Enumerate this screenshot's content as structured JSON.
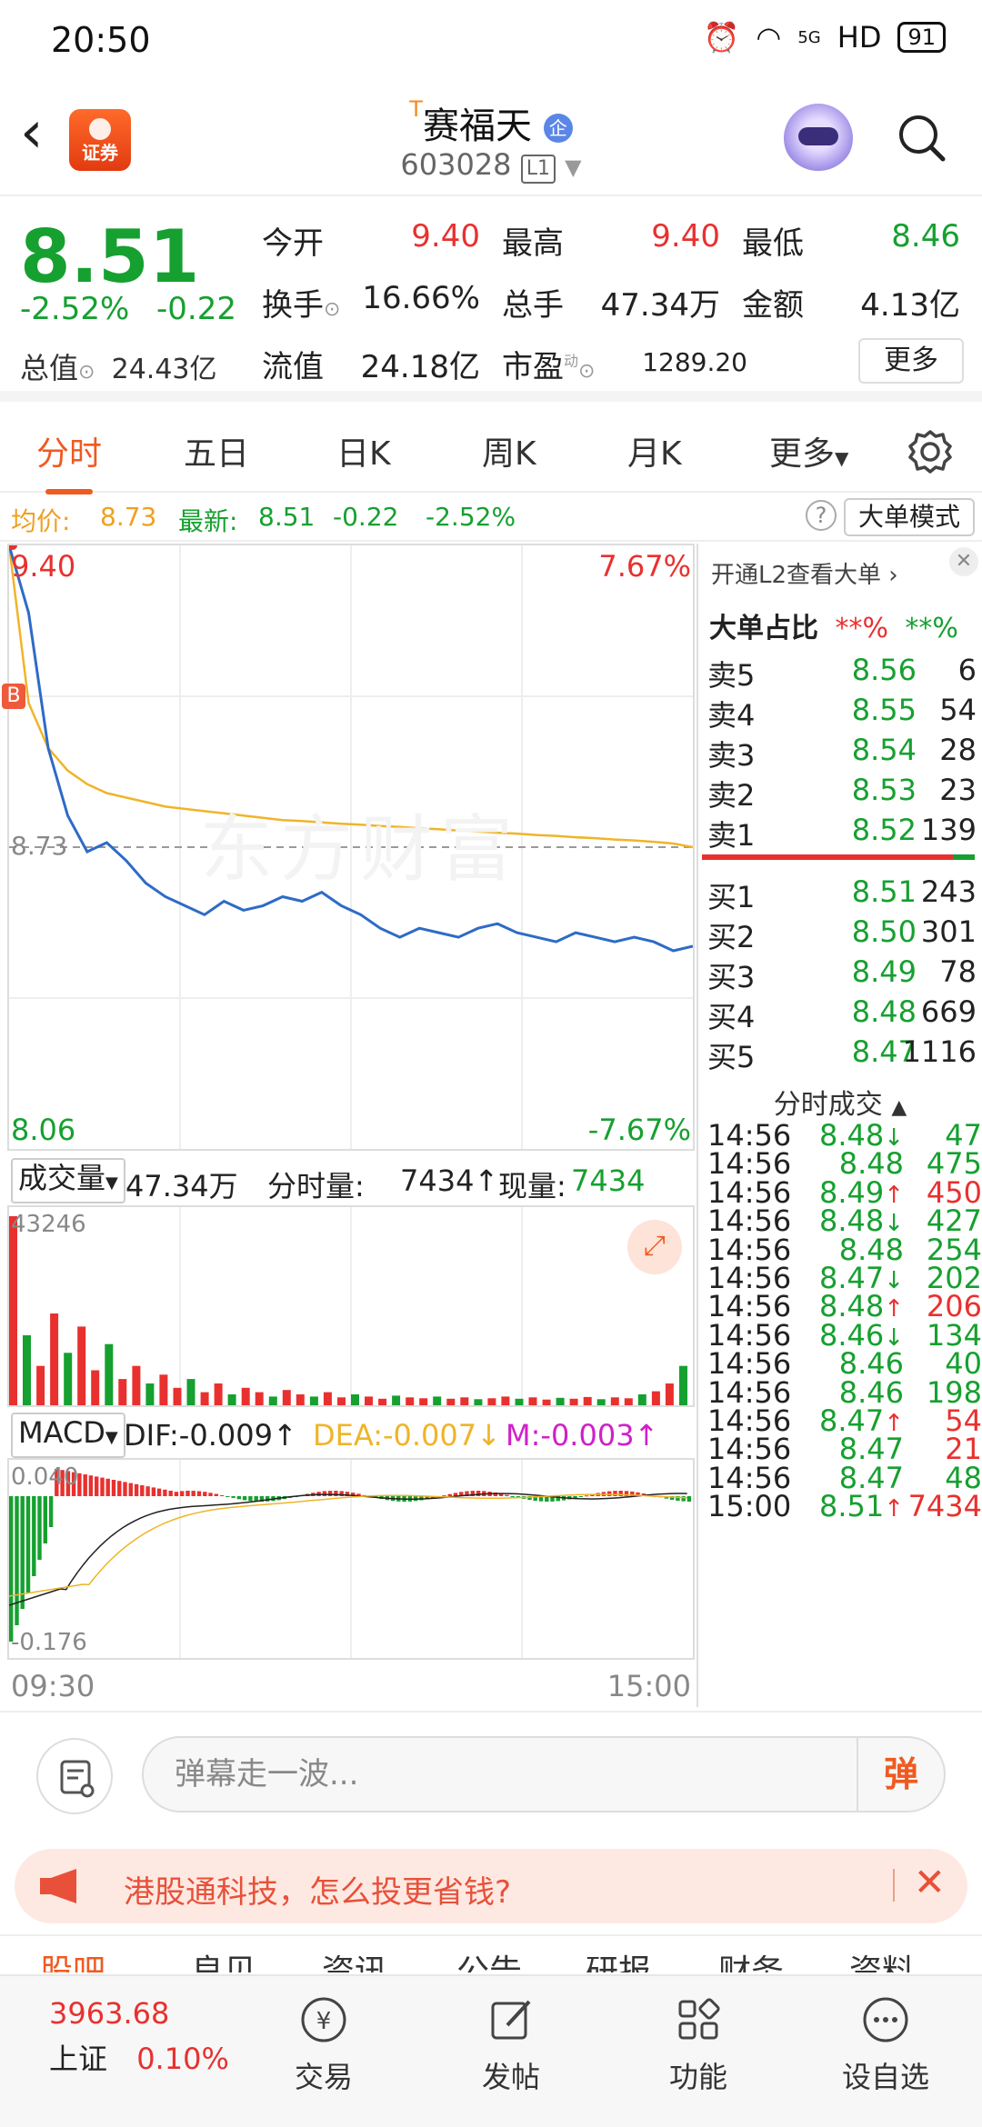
{
  "status_bar": {
    "time": "20:50",
    "network": "5G",
    "hd": "HD",
    "battery": "91"
  },
  "header": {
    "logo_label": "证券",
    "stock_name": "赛福天",
    "name_prefix": "T",
    "tag": "企",
    "stock_code": "603028",
    "level_badge": "L1"
  },
  "quote": {
    "price": "8.51",
    "change_pct": "-2.52%",
    "change": "-0.22",
    "open_label": "今开",
    "open": "9.40",
    "high_label": "最高",
    "high": "9.40",
    "low_label": "最低",
    "low": "8.46",
    "turnover_label": "换手",
    "turnover": "16.66%",
    "volume_label": "总手",
    "volume": "47.34万",
    "amount_label": "金额",
    "amount": "4.13亿",
    "mktcap_label": "总值",
    "mktcap": "24.43亿",
    "float_label": "流值",
    "float": "24.18亿",
    "pe_label": "市盈",
    "pe_sup": "动",
    "pe": "1289.20",
    "more_label": "更多"
  },
  "tabs": [
    "分时",
    "五日",
    "日K",
    "周K",
    "月K",
    "更多"
  ],
  "avg_row": {
    "avg_label": "均价:",
    "avg": "8.73",
    "latest_label": "最新:",
    "latest": "8.51",
    "chg": "-0.22",
    "chg_pct": "-2.52%",
    "help": "?",
    "mode_button": "大单模式"
  },
  "chart_labels": {
    "top_price": "9.40",
    "top_pct": "7.67%",
    "bottom_price": "8.06",
    "bottom_pct": "-7.67%",
    "mid_price": "8.73",
    "watermark": "东方财富",
    "b_marker": "B"
  },
  "chart_data": {
    "type": "line",
    "x_range": [
      "09:30",
      "15:00"
    ],
    "ylim": [
      8.06,
      9.4
    ],
    "prev_close": 8.73,
    "series": [
      {
        "name": "最新",
        "color": "#2e6bc6",
        "values": [
          9.4,
          9.25,
          8.95,
          8.8,
          8.72,
          8.74,
          8.7,
          8.65,
          8.62,
          8.6,
          8.58,
          8.61,
          8.59,
          8.6,
          8.62,
          8.61,
          8.63,
          8.6,
          8.58,
          8.55,
          8.53,
          8.55,
          8.54,
          8.53,
          8.55,
          8.56,
          8.54,
          8.53,
          8.52,
          8.54,
          8.53,
          8.52,
          8.53,
          8.52,
          8.5,
          8.51
        ]
      },
      {
        "name": "均价",
        "color": "#f0b429",
        "values": [
          9.4,
          9.05,
          8.95,
          8.9,
          8.87,
          8.85,
          8.84,
          8.83,
          8.82,
          8.815,
          8.81,
          8.805,
          8.8,
          8.795,
          8.79,
          8.788,
          8.785,
          8.782,
          8.78,
          8.777,
          8.775,
          8.772,
          8.77,
          8.767,
          8.765,
          8.762,
          8.76,
          8.757,
          8.755,
          8.752,
          8.75,
          8.747,
          8.745,
          8.742,
          8.738,
          8.73
        ]
      }
    ]
  },
  "volume": {
    "selector": "成交量",
    "total": "47.34万",
    "tick_label": "分时量:",
    "tick": "7434",
    "current_label": "现量:",
    "current": "7434",
    "max": "43246"
  },
  "volume_data": [
    43246,
    16000,
    9000,
    21000,
    12000,
    18000,
    8000,
    14000,
    6000,
    9000,
    5000,
    7000,
    4000,
    6000,
    3000,
    5000,
    2500,
    4000,
    3000,
    2000,
    3500,
    2500,
    2000,
    3000,
    1800,
    2500,
    2000,
    1500,
    2200,
    1800,
    1600,
    2000,
    1500,
    1800,
    1400,
    1600,
    2000,
    1500,
    1800,
    1300,
    1700,
    1500,
    1900,
    1400,
    1800,
    1600,
    2500,
    3200,
    5000,
    9000
  ],
  "macd": {
    "selector": "MACD",
    "dif_label": "DIF:",
    "dif": "-0.009",
    "dea_label": "DEA:",
    "dea": "-0.007",
    "m_label": "M:",
    "m": "-0.003",
    "top": "0.040",
    "bottom": "-0.176"
  },
  "time_axis": {
    "start": "09:30",
    "end": "15:00"
  },
  "order_book": {
    "l2_link": "开通L2查看大单",
    "big_ratio_label": "大单占比",
    "big_ratio_a": "**%",
    "big_ratio_b": "**%",
    "asks": [
      {
        "name": "卖5",
        "price": "8.56",
        "qty": "6"
      },
      {
        "name": "卖4",
        "price": "8.55",
        "qty": "54"
      },
      {
        "name": "卖3",
        "price": "8.54",
        "qty": "28"
      },
      {
        "name": "卖2",
        "price": "8.53",
        "qty": "23"
      },
      {
        "name": "卖1",
        "price": "8.52",
        "qty": "139"
      }
    ],
    "bids": [
      {
        "name": "买1",
        "price": "8.51",
        "qty": "243"
      },
      {
        "name": "买2",
        "price": "8.50",
        "qty": "301"
      },
      {
        "name": "买3",
        "price": "8.49",
        "qty": "78"
      },
      {
        "name": "买4",
        "price": "8.48",
        "qty": "669"
      },
      {
        "name": "买5",
        "price": "8.47",
        "qty": "1116"
      }
    ],
    "trades_label": "分时成交",
    "trades": [
      {
        "time": "14:56",
        "price": "8.48",
        "arrow": "↓",
        "qty": "47",
        "dir": "down"
      },
      {
        "time": "14:56",
        "price": "8.48",
        "arrow": "",
        "qty": "475",
        "dir": "flat"
      },
      {
        "time": "14:56",
        "price": "8.49",
        "arrow": "↑",
        "qty": "450",
        "dir": "up"
      },
      {
        "time": "14:56",
        "price": "8.48",
        "arrow": "↓",
        "qty": "427",
        "dir": "down"
      },
      {
        "time": "14:56",
        "price": "8.48",
        "arrow": "",
        "qty": "254",
        "dir": "flat"
      },
      {
        "time": "14:56",
        "price": "8.47",
        "arrow": "↓",
        "qty": "202",
        "dir": "down"
      },
      {
        "time": "14:56",
        "price": "8.48",
        "arrow": "↑",
        "qty": "206",
        "dir": "up"
      },
      {
        "time": "14:56",
        "price": "8.46",
        "arrow": "↓",
        "qty": "134",
        "dir": "down"
      },
      {
        "time": "14:56",
        "price": "8.46",
        "arrow": "",
        "qty": "40",
        "dir": "flat"
      },
      {
        "time": "14:56",
        "price": "8.46",
        "arrow": "",
        "qty": "198",
        "dir": "flat"
      },
      {
        "time": "14:56",
        "price": "8.47",
        "arrow": "↑",
        "qty": "54",
        "dir": "up"
      },
      {
        "time": "14:56",
        "price": "8.47",
        "arrow": "",
        "qty": "21",
        "dir": "upflat"
      },
      {
        "time": "14:56",
        "price": "8.47",
        "arrow": "",
        "qty": "48",
        "dir": "flat"
      },
      {
        "time": "15:00",
        "price": "8.51",
        "arrow": "↑",
        "qty": "7434",
        "dir": "up"
      }
    ]
  },
  "danmu": {
    "placeholder": "弹幕走一波...",
    "send": "弹"
  },
  "promo": {
    "text": "港股通科技，怎么投更省钱?"
  },
  "sub_tabs": [
    "股吧",
    "良贝",
    "资讯",
    "公告",
    "研报",
    "财务",
    "资料"
  ],
  "bottom_nav": {
    "index_value": "3963.68",
    "index_name": "上证",
    "index_change": "0.10%",
    "items": [
      "交易",
      "发帖",
      "功能",
      "设自选"
    ]
  },
  "colors": {
    "up": "#e8312f",
    "down": "#16a030",
    "accent": "#ef5a21",
    "price_line": "#2e6bc6",
    "avg_line": "#f0b429"
  }
}
